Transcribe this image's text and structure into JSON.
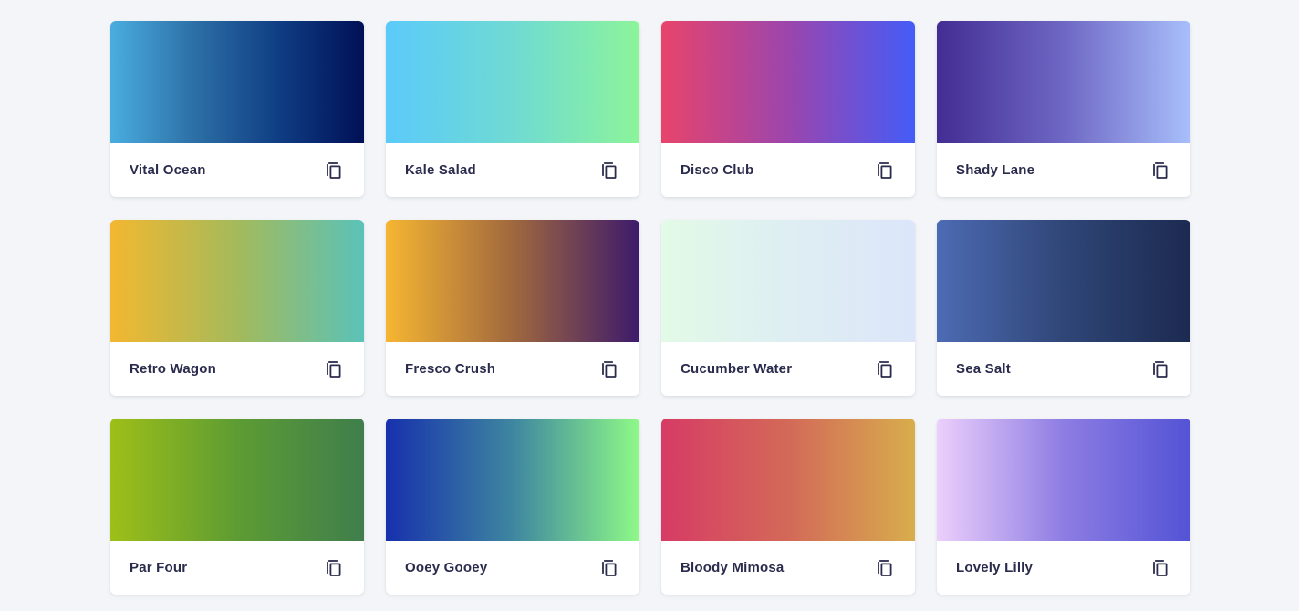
{
  "gradients": [
    {
      "name": "Vital Ocean",
      "colors": [
        "#4aaddf",
        "#2c6fa6",
        "#0f3d83",
        "#001056"
      ]
    },
    {
      "name": "Kale Salad",
      "colors": [
        "#5bcafa",
        "#6fdad3",
        "#8cf49a"
      ]
    },
    {
      "name": "Disco Club",
      "colors": [
        "#e8446b",
        "#9c45ad",
        "#445cf7"
      ]
    },
    {
      "name": "Shady Lane",
      "colors": [
        "#432d92",
        "#6e67c4",
        "#a8bffb"
      ]
    },
    {
      "name": "Retro Wagon",
      "colors": [
        "#f3b730",
        "#a4ba5b",
        "#5ac2b8"
      ]
    },
    {
      "name": "Fresco Crush",
      "colors": [
        "#f6b632",
        "#a0683e",
        "#3d1a6b"
      ]
    },
    {
      "name": "Cucumber Water",
      "colors": [
        "#e2fae7",
        "#deeef2",
        "#dce6fa"
      ]
    },
    {
      "name": "Sea Salt",
      "colors": [
        "#4d6bb4",
        "#2f4677",
        "#1c2a50"
      ]
    },
    {
      "name": "Par Four",
      "colors": [
        "#9ebf18",
        "#5d9c33",
        "#3f7e4c"
      ]
    },
    {
      "name": "Ooey Gooey",
      "colors": [
        "#1730ad",
        "#3e86a0",
        "#8ef987"
      ]
    },
    {
      "name": "Bloody Mimosa",
      "colors": [
        "#d73b65",
        "#d36958",
        "#d8ad4c"
      ]
    },
    {
      "name": "Lovely Lilly",
      "colors": [
        "#eccffb",
        "#8d7de3",
        "#5353d5"
      ]
    }
  ]
}
